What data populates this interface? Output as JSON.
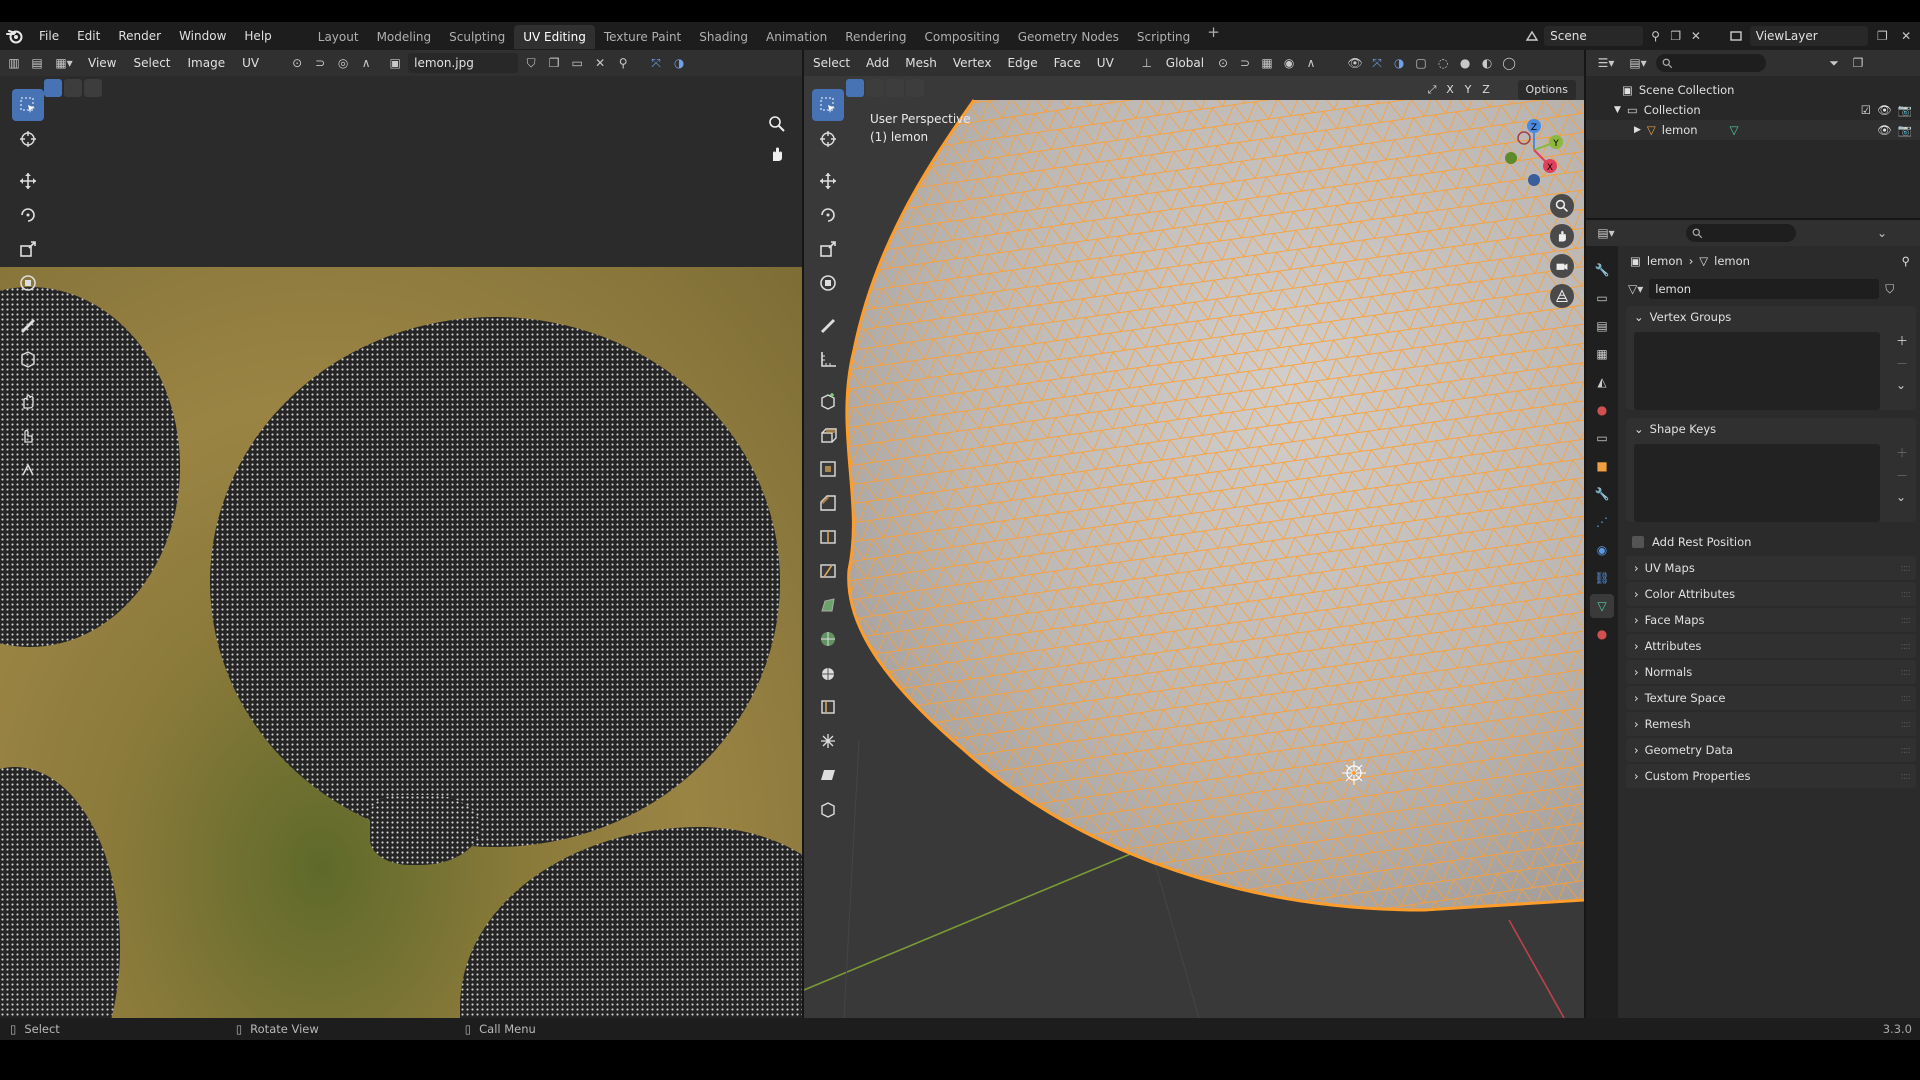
{
  "topbar": {
    "menus": [
      "File",
      "Edit",
      "Render",
      "Window",
      "Help"
    ],
    "workspaces": [
      "Layout",
      "Modeling",
      "Sculpting",
      "UV Editing",
      "Texture Paint",
      "Shading",
      "Animation",
      "Rendering",
      "Compositing",
      "Geometry Nodes",
      "Scripting"
    ],
    "active_workspace": "UV Editing",
    "add_tab": "+",
    "scene": "Scene",
    "view_layer": "ViewLayer"
  },
  "uv_editor": {
    "menus": [
      "View",
      "Select",
      "Image",
      "UV"
    ],
    "image_name": "lemon.jpg"
  },
  "viewport": {
    "menus": [
      "Select",
      "Add",
      "Mesh",
      "Vertex",
      "Edge",
      "Face",
      "UV"
    ],
    "transform_orientation": "Global",
    "perspective": "User Perspective",
    "object_label": "(1) lemon",
    "options_label": "Options",
    "axes": [
      "X",
      "Y",
      "Z"
    ],
    "gizmo": {
      "x": "X",
      "y": "Y",
      "z": "Z"
    },
    "colors": {
      "x_axis": "#e0405a",
      "y_axis": "#8bb83d",
      "z_axis": "#4a8ae0",
      "wire": "#ff9d2b",
      "mesh": "#bdb8b5"
    }
  },
  "outliner": {
    "scene_collection": "Scene Collection",
    "collection": "Collection",
    "object": "lemon"
  },
  "properties": {
    "breadcrumb_object": "lemon",
    "breadcrumb_mesh": "lemon",
    "mesh_name": "lemon",
    "vertex_groups": "Vertex Groups",
    "shape_keys": "Shape Keys",
    "add_rest_position": "Add Rest Position",
    "collapsed_panels": [
      "UV Maps",
      "Color Attributes",
      "Face Maps",
      "Attributes",
      "Normals",
      "Texture Space",
      "Remesh",
      "Geometry Data",
      "Custom Properties"
    ]
  },
  "statusbar": {
    "select": "Select",
    "rotate_view": "Rotate View",
    "call_menu": "Call Menu",
    "version": "3.3.0"
  },
  "accent": "#4772b3"
}
